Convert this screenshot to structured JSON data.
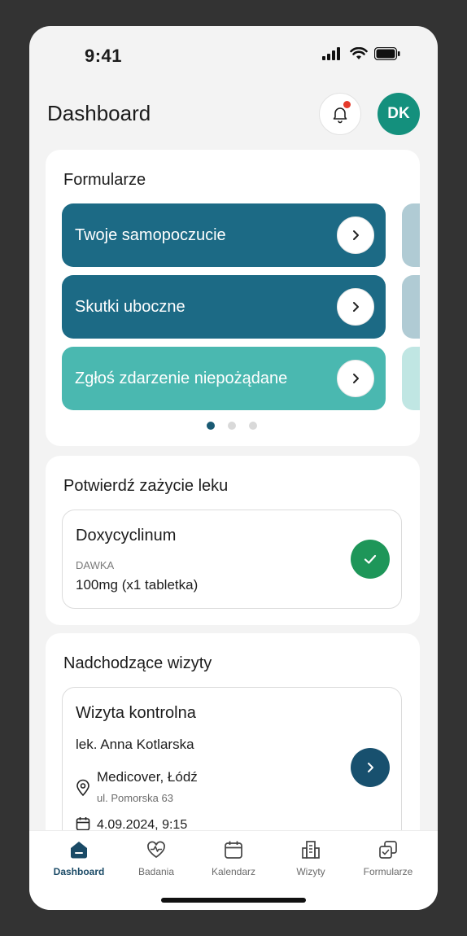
{
  "status": {
    "time": "9:41"
  },
  "header": {
    "title": "Dashboard",
    "avatar_initials": "DK"
  },
  "forms": {
    "title": "Formularze",
    "items": [
      {
        "label": "Twoje samopoczucie",
        "color": "#1c6a85"
      },
      {
        "label": "Skutki uboczne",
        "color": "#1c6a85"
      },
      {
        "label": "Zgłoś zdarzenie niepożądane",
        "color": "#4ab8b0"
      }
    ],
    "pager": {
      "pages": 3,
      "active": 1
    }
  },
  "medication": {
    "title": "Potwierdź zażycie leku",
    "name": "Doxycyclinum",
    "dose_label": "DAWKA",
    "dose": "100mg (x1 tabletka)"
  },
  "visits": {
    "title": "Nadchodzące wizyty",
    "item": {
      "title": "Wizyta kontrolna",
      "doctor": "lek. Anna Kotlarska",
      "place": "Medicover, Łódź",
      "street": "ul. Pomorska 63",
      "date": "4.09.2024, 9:15"
    }
  },
  "tabbar": {
    "tabs": [
      {
        "label": "Dashboard",
        "icon": "home-icon",
        "active": true
      },
      {
        "label": "Badania",
        "icon": "heart-pulse-icon"
      },
      {
        "label": "Kalendarz",
        "icon": "calendar-icon"
      },
      {
        "label": "Wizyty",
        "icon": "building-icon"
      },
      {
        "label": "Formularze",
        "icon": "forms-icon"
      }
    ]
  },
  "colors": {
    "accent": "#1a4a66",
    "teal": "#1c6a85",
    "teal_light": "#4ab8b0",
    "avatar": "#14907d",
    "confirm": "#1e9659"
  }
}
